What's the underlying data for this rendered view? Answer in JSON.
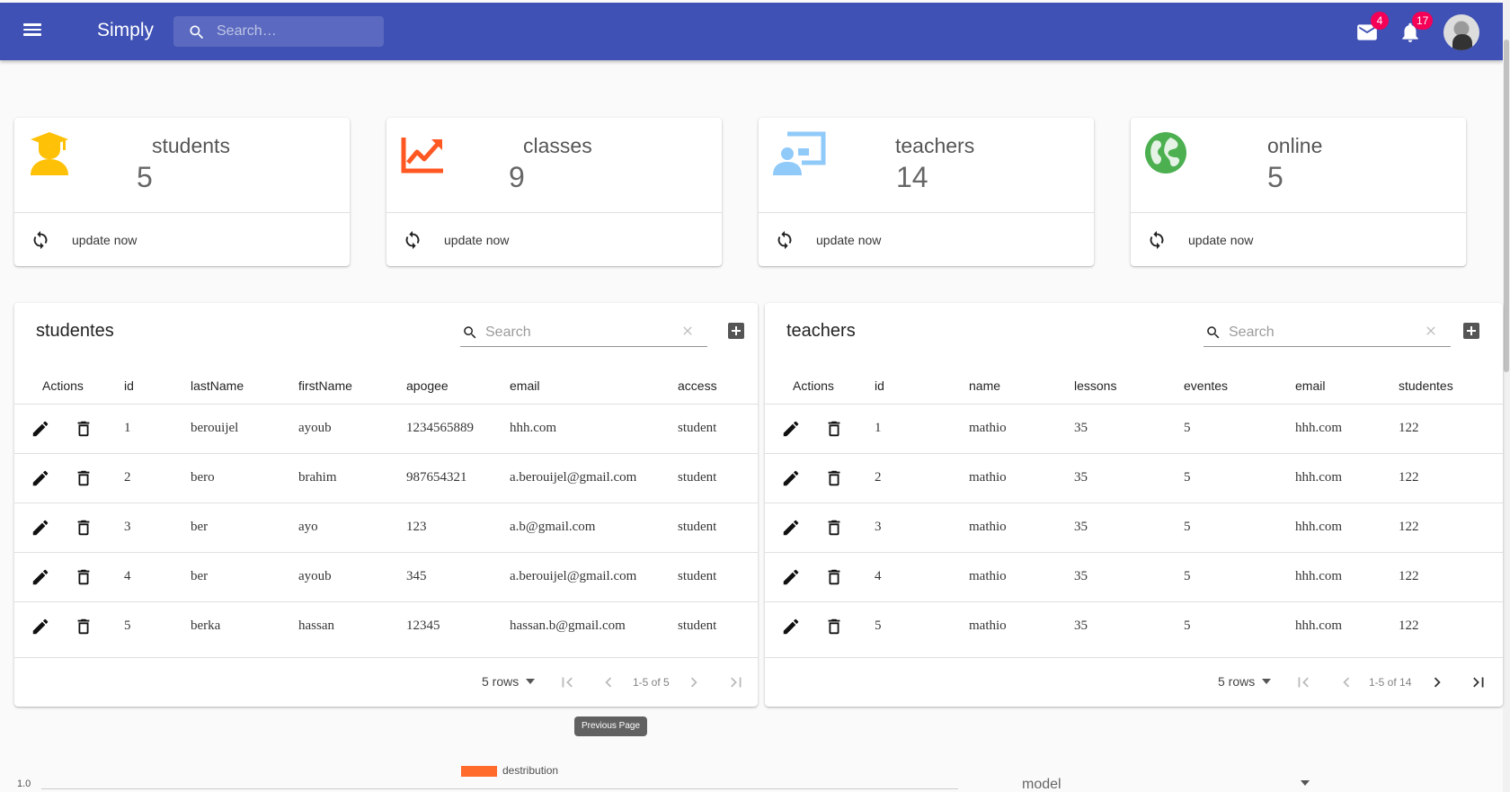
{
  "appbar": {
    "brand": "Simply",
    "search_placeholder": "Search…",
    "mail_badge": "4",
    "notifications_badge": "17",
    "color": "#3f51b5"
  },
  "cards": [
    {
      "title": "students",
      "value": "5",
      "action": "update now",
      "icon": "school-icon",
      "color": "#ffc107"
    },
    {
      "title": "classes",
      "value": "9",
      "action": "update now",
      "icon": "trending-up-icon",
      "color": "#ff5722"
    },
    {
      "title": "teachers",
      "value": "14",
      "action": "update now",
      "icon": "co-present-icon",
      "color": "#90caf9"
    },
    {
      "title": "online",
      "value": "5",
      "action": "update now",
      "icon": "public-globe-icon",
      "color": "#4caf50"
    }
  ],
  "students_table": {
    "title": "studentes",
    "search_placeholder": "Search",
    "columns": [
      "Actions",
      "id",
      "lastName",
      "firstName",
      "apogee",
      "email",
      "access"
    ],
    "rows": [
      [
        "1",
        "berouijel",
        "ayoub",
        "1234565889",
        "hhh.com",
        "student"
      ],
      [
        "2",
        "bero",
        "brahim",
        "987654321",
        "a.berouijel@gmail.com",
        "student"
      ],
      [
        "3",
        "ber",
        "ayo",
        "123",
        "a.b@gmail.com",
        "student"
      ],
      [
        "4",
        "ber",
        "ayoub",
        "345",
        "a.berouijel@gmail.com",
        "student"
      ],
      [
        "5",
        "berka",
        "hassan",
        "12345",
        "hassan.b@gmail.com",
        "student"
      ]
    ],
    "rows_per_page": "5 rows",
    "range": "1-5 of 5"
  },
  "teachers_table": {
    "title": "teachers",
    "search_placeholder": "Search",
    "columns": [
      "Actions",
      "id",
      "name",
      "lessons",
      "eventes",
      "email",
      "studentes"
    ],
    "rows": [
      [
        "1",
        "mathio",
        "35",
        "5",
        "hhh.com",
        "122"
      ],
      [
        "2",
        "mathio",
        "35",
        "5",
        "hhh.com",
        "122"
      ],
      [
        "3",
        "mathio",
        "35",
        "5",
        "hhh.com",
        "122"
      ],
      [
        "4",
        "mathio",
        "35",
        "5",
        "hhh.com",
        "122"
      ],
      [
        "5",
        "mathio",
        "35",
        "5",
        "hhh.com",
        "122"
      ]
    ],
    "rows_per_page": "5 rows",
    "range": "1-5 of 14"
  },
  "tooltip": "Previous Page",
  "chart": {
    "legend": "destribution",
    "legend_color": "#ff6b2b",
    "ytick_top": "1.0",
    "select_label": "model"
  }
}
